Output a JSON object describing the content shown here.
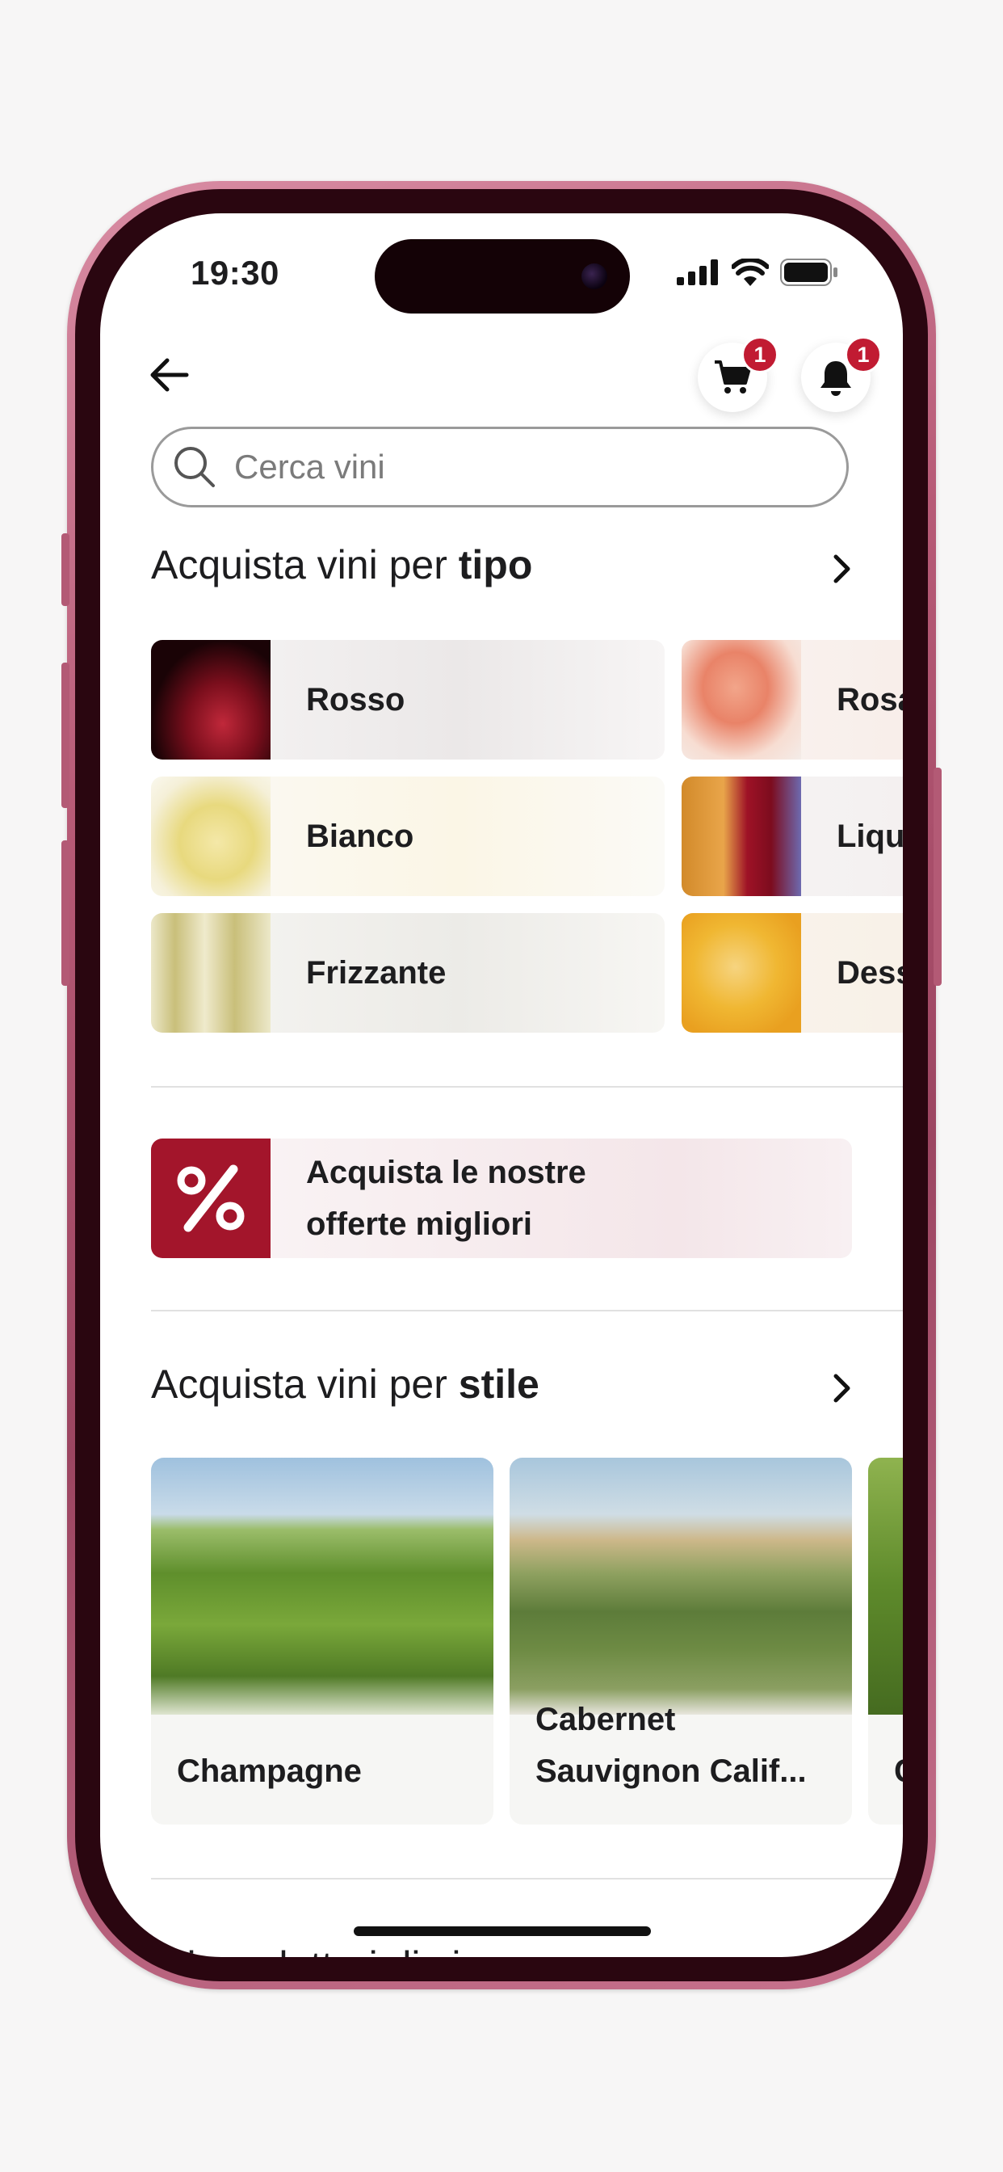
{
  "status_bar": {
    "time": "19:30"
  },
  "header": {
    "cart_badge": "1",
    "notifications_badge": "1"
  },
  "search": {
    "placeholder": "Cerca vini",
    "value": ""
  },
  "section_type": {
    "title_prefix": "Acquista vini per",
    "title_bold": "tipo",
    "items": [
      {
        "label": "Rosso"
      },
      {
        "label": "Rosa"
      },
      {
        "label": "Bianco"
      },
      {
        "label": "Liqu"
      },
      {
        "label": "Frizzante"
      },
      {
        "label": "Dess"
      }
    ]
  },
  "offers": {
    "label_line1": "Acquista le nostre",
    "label_line2": "offerte migliori"
  },
  "section_style": {
    "title_prefix": "Acquista vini per",
    "title_bold": "stile",
    "items": [
      {
        "label": "Champagne"
      },
      {
        "label": "Cabernet Sauvignon Calif..."
      },
      {
        "label": "C"
      }
    ]
  },
  "next_section_peek": "ori produttori di vino",
  "icons": [
    "back-arrow-icon",
    "cart-icon",
    "bell-icon",
    "search-icon",
    "chevron-right-icon",
    "percent-icon",
    "signal-icon",
    "wifi-icon",
    "battery-icon"
  ],
  "colors": {
    "accent": "#a3152b",
    "badge": "#c11b32",
    "frame": "#b75a76"
  }
}
